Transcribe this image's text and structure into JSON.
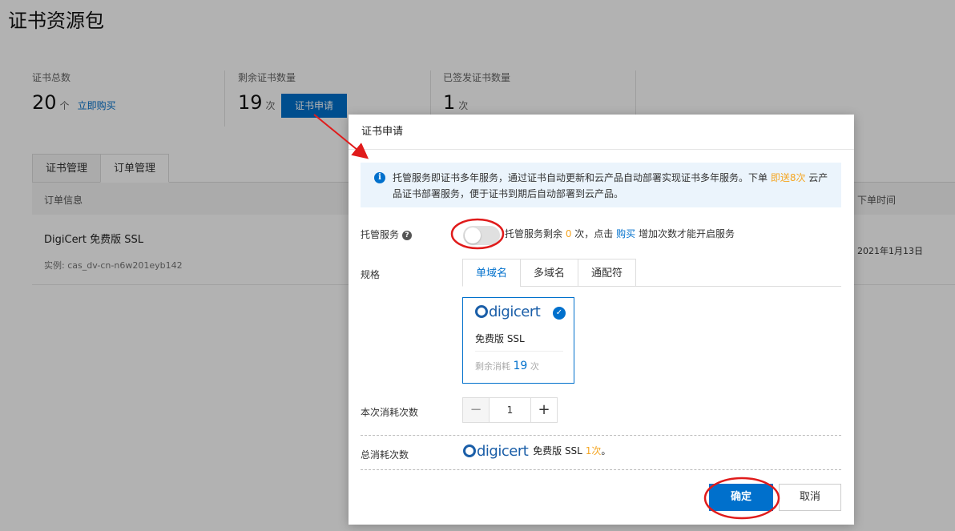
{
  "page": {
    "title": "证书资源包",
    "stats": [
      {
        "label": "证书总数",
        "value": "20",
        "unit": "个",
        "link": "立即购买"
      },
      {
        "label": "剩余证书数量",
        "value": "19",
        "unit": "次",
        "button": "证书申请"
      },
      {
        "label": "已签发证书数量",
        "value": "1",
        "unit": "次"
      }
    ],
    "tabs": [
      "证书管理",
      "订单管理"
    ],
    "table": {
      "headers": [
        "订单信息",
        "下单时间"
      ],
      "row": {
        "name": "DigiCert 免费版 SSL",
        "instance": "实例: cas_dv-cn-n6w201eyb142",
        "date": "2021年1月13日"
      }
    }
  },
  "modal": {
    "title": "证书申请",
    "notice": {
      "text1": "托管服务即证书多年服务，通过证书自动更新和云产品自动部署实现证书多年服务。下单 ",
      "highlight": "即送8次",
      "text2": " 云产品证书部署服务，便于证书到期后自动部署到云产品。"
    },
    "hosting": {
      "label": "托管服务",
      "help_icon": "?",
      "text1": "托管服务剩余 ",
      "count": "0",
      "text2": " 次，点击 ",
      "link": "购买",
      "text3": " 增加次数才能开启服务",
      "enabled": false
    },
    "spec": {
      "label": "规格",
      "tabs": [
        "单域名",
        "多域名",
        "通配符"
      ],
      "selected": "单域名"
    },
    "card": {
      "brand": "digicert",
      "name": "免费版 SSL",
      "remain_label": "剩余消耗",
      "remain_count": "19",
      "remain_unit": "次"
    },
    "consume": {
      "label": "本次消耗次数",
      "minus": "−",
      "value": "1",
      "plus": "+"
    },
    "total": {
      "label": "总消耗次数",
      "brand": "digicert",
      "product": "免费版 SSL",
      "count": "1次",
      "suffix": "。"
    },
    "confirm": "确定",
    "cancel": "取消"
  },
  "colors": {
    "accent": "#0070cc",
    "highlight": "#f5a623",
    "annotation": "#e01b1b"
  }
}
